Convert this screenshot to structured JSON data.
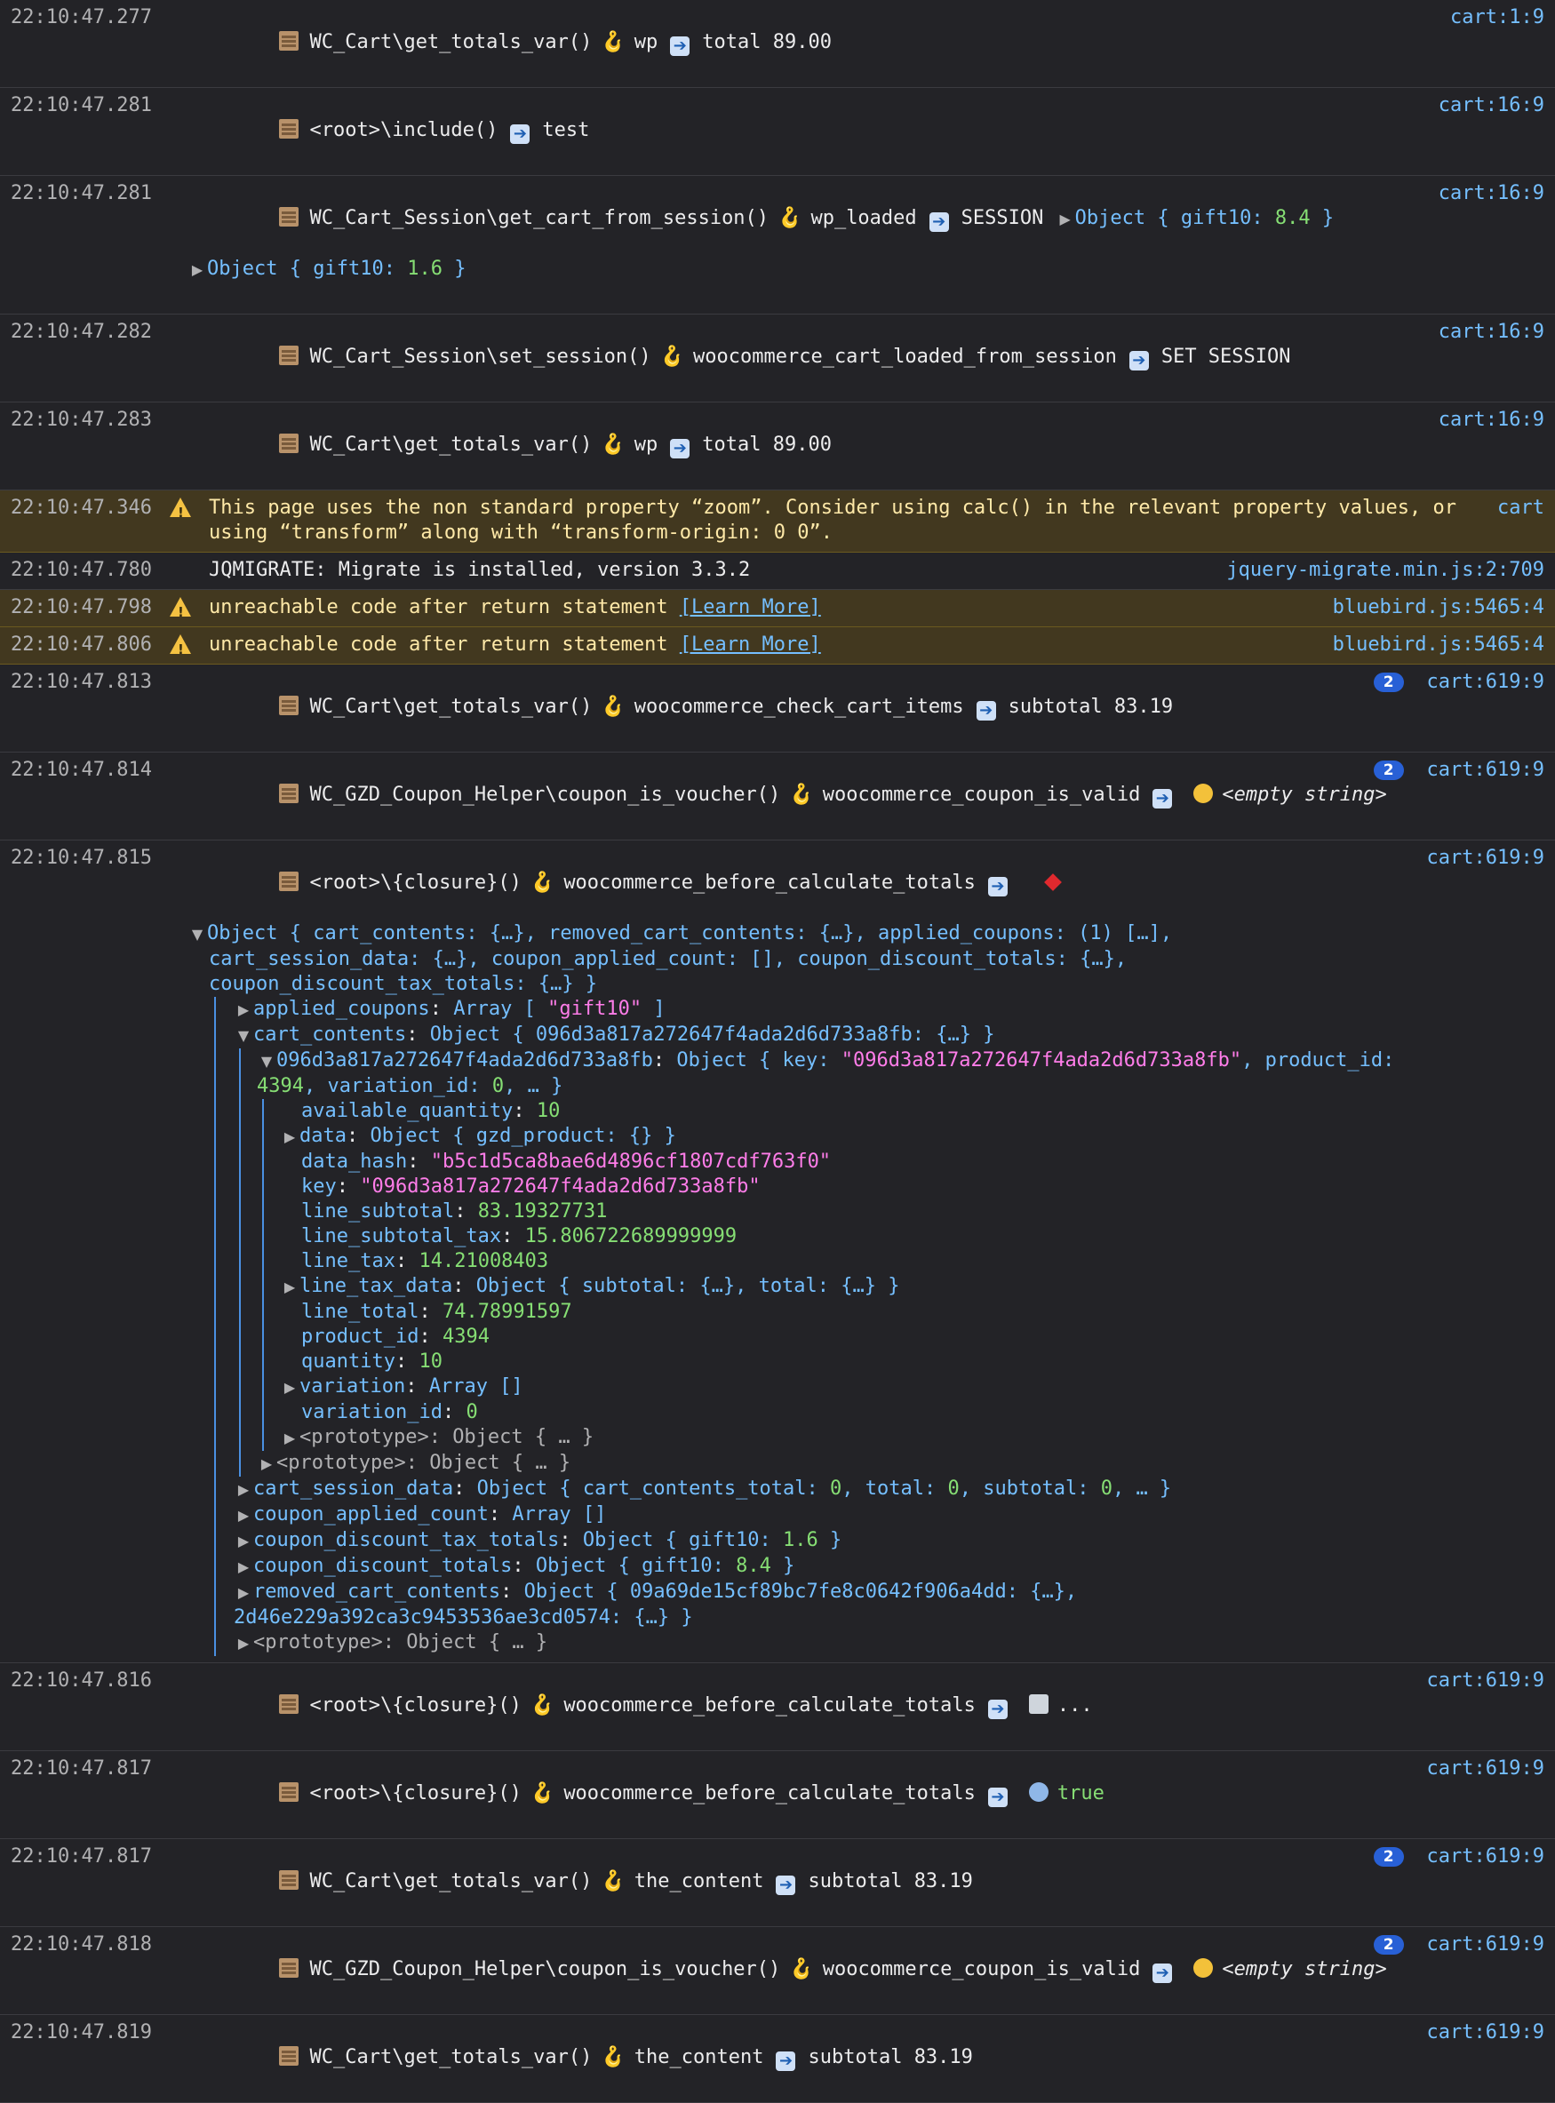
{
  "rows": [
    {
      "time": "22:10:47.277",
      "func": "WC_Cart\\get_totals_var()",
      "hook": "wp",
      "value": "total 89.00",
      "src": "cart:1:9"
    },
    {
      "time": "22:10:47.281",
      "func": "<root>\\include()",
      "value": "test",
      "src": "cart:16:9"
    },
    {
      "time": "22:10:47.281",
      "func": "WC_Cart_Session\\get_cart_from_session()",
      "hook": "wp_loaded",
      "value": "SESSION",
      "obj1_prefix": "Object { ",
      "obj1_key": "gift10",
      "obj1_val": "8.4",
      "obj2_key": "gift10",
      "obj2_val": "1.6",
      "src": "cart:16:9"
    },
    {
      "time": "22:10:47.282",
      "func": "WC_Cart_Session\\set_session()",
      "hook": "woocommerce_cart_loaded_from_session",
      "value": "SET SESSION",
      "src": "cart:16:9"
    },
    {
      "time": "22:10:47.283",
      "func": "WC_Cart\\get_totals_var()",
      "hook": "wp",
      "value": "total 89.00",
      "src": "cart:16:9"
    },
    {
      "time": "22:10:47.346",
      "text": "This page uses the non standard property “zoom”. Consider using calc() in the relevant property values, or using “transform” along with “transform-origin: 0 0”.",
      "src": "cart"
    },
    {
      "time": "22:10:47.780",
      "text": "JQMIGRATE: Migrate is installed, version 3.3.2",
      "src": "jquery-migrate.min.js:2:709"
    },
    {
      "time": "22:10:47.798",
      "text": "unreachable code after return statement ",
      "link": "[Learn More]",
      "src": "bluebird.js:5465:4"
    },
    {
      "time": "22:10:47.806",
      "text": "unreachable code after return statement ",
      "link": "[Learn More]",
      "src": "bluebird.js:5465:4"
    },
    {
      "time": "22:10:47.813",
      "func": "WC_Cart\\get_totals_var()",
      "hook": "woocommerce_check_cart_items",
      "value": "subtotal 83.19",
      "badge": "2",
      "src": "cart:619:9"
    },
    {
      "time": "22:10:47.814",
      "func": "WC_GZD_Coupon_Helper\\coupon_is_voucher()",
      "hook": "woocommerce_coupon_is_valid",
      "value": "<empty string>",
      "badge": "2",
      "src": "cart:619:9"
    },
    {
      "time": "22:10:47.815",
      "func": "<root>\\{closure}()",
      "hook": "woocommerce_before_calculate_totals",
      "src": "cart:619:9"
    },
    {
      "time": "22:10:47.816",
      "func": "<root>\\{closure}()",
      "hook": "woocommerce_before_calculate_totals",
      "value": "...",
      "src": "cart:619:9"
    },
    {
      "time": "22:10:47.817",
      "func": "<root>\\{closure}()",
      "hook": "woocommerce_before_calculate_totals",
      "value": "true",
      "src": "cart:619:9"
    },
    {
      "time": "22:10:47.817",
      "func": "WC_Cart\\get_totals_var()",
      "hook": "the_content",
      "value": "subtotal 83.19",
      "badge": "2",
      "src": "cart:619:9"
    },
    {
      "time": "22:10:47.818",
      "func": "WC_GZD_Coupon_Helper\\coupon_is_voucher()",
      "hook": "woocommerce_coupon_is_valid",
      "value": "<empty string>",
      "badge": "2",
      "src": "cart:619:9"
    },
    {
      "time": "22:10:47.819",
      "func": "WC_Cart\\get_totals_var()",
      "hook": "the_content",
      "value": "subtotal 83.19",
      "src": "cart:619:9"
    }
  ],
  "tree": {
    "summary1": "Object { cart_contents: {…}, removed_cart_contents: {…}, applied_coupons: (1) […],",
    "summary2": "cart_session_data: {…}, coupon_applied_count: [], coupon_discount_totals: {…},",
    "summary3": "coupon_discount_tax_totals: {…} }",
    "applied_coupons_key": "applied_coupons",
    "applied_coupons_pre": "Array [ ",
    "applied_coupons_val": "\"gift10\"",
    "applied_coupons_post": " ]",
    "cart_contents_key": "cart_contents",
    "cart_contents_pre": "Object { ",
    "cart_contents_inner": "096d3a817a272647f4ada2d6d733a8fb",
    "cart_contents_post": ": {…} }",
    "item_key": "096d3a817a272647f4ada2d6d733a8fb",
    "item_pre": "Object { key: ",
    "item_keyval": "\"096d3a817a272647f4ada2d6d733a8fb\"",
    "item_mid": ", product_id:",
    "item_pid": "4394",
    "item_mid2": ", variation_id: ",
    "item_vid": "0",
    "item_post": ", … }",
    "available_quantity": "10",
    "data_obj": "Object { gzd_product: {} }",
    "data_hash": "\"b5c1d5ca8bae6d4896cf1807cdf763f0\"",
    "key": "\"096d3a817a272647f4ada2d6d733a8fb\"",
    "line_subtotal": "83.19327731",
    "line_subtotal_tax": "15.806722689999999",
    "line_tax": "14.21008403",
    "line_tax_data": "Object { subtotal: {…}, total: {…} }",
    "line_total": "74.78991597",
    "product_id": "4394",
    "quantity": "10",
    "variation": "Array []",
    "variation_id": "0",
    "prototype": "Object { … }",
    "cart_session_data_pre": "Object { cart_contents_total: ",
    "cart_session_data_v1": "0",
    "cart_session_data_mid": ", total: ",
    "cart_session_data_v2": "0",
    "cart_session_data_mid2": ", subtotal: ",
    "cart_session_data_v3": "0",
    "cart_session_data_post": ", … }",
    "coupon_applied_count": "Array []",
    "coupon_discount_tax_totals_pre": "Object { gift10: ",
    "coupon_discount_tax_totals_val": "1.6",
    "coupon_discount_totals_pre": "Object { gift10: ",
    "coupon_discount_totals_val": "8.4",
    "removed_pre": "Object { 09a69de15cf89bc7fe8c0642f906a4dd: {…},",
    "removed_2": "2d46e229a392ca3c9453536ae3cd0574: {…} }"
  }
}
